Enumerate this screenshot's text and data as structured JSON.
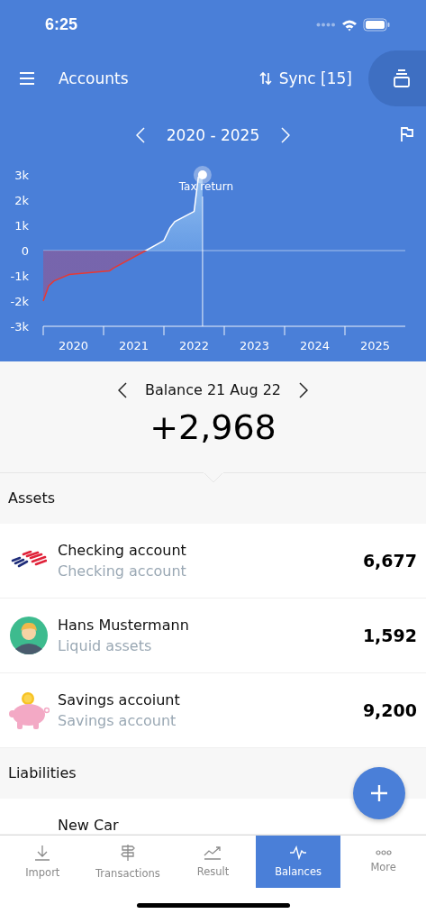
{
  "status_bar": {
    "time": "6:25"
  },
  "header": {
    "title": "Accounts",
    "sync": "Sync [15]"
  },
  "period": {
    "label": "2020 - 2025"
  },
  "chart": {
    "chart_data": {
      "type": "area",
      "x": [
        2020.0,
        2020.09,
        2020.18,
        2020.43,
        2021.1,
        2021.16,
        2021.7,
        2022.0,
        2022.1,
        2022.18,
        2022.5,
        2022.57,
        2022.64
      ],
      "series": [
        {
          "color": "#ffffff",
          "values": [
            -2000,
            -1400,
            -1200,
            -950,
            -800,
            -700,
            0,
            400,
            900,
            1150,
            1550,
            2900,
            3000
          ]
        }
      ],
      "ref_lines": [
        {
          "axis": "x",
          "value": 2022.64
        }
      ],
      "xlim": [
        2020,
        2026
      ],
      "ylim": [
        -3000,
        3000
      ],
      "xticks": [
        {
          "value": 2020.5,
          "label": "2020"
        },
        {
          "value": 2021.5,
          "label": "2021"
        },
        {
          "value": 2022.5,
          "label": "2022"
        },
        {
          "value": 2023.5,
          "label": "2023"
        },
        {
          "value": 2024.5,
          "label": "2024"
        },
        {
          "value": 2025.5,
          "label": "2025"
        }
      ],
      "yticks": [
        {
          "value": 3000,
          "label": "3k"
        },
        {
          "value": 2000,
          "label": "2k"
        },
        {
          "value": 1000,
          "label": "1k"
        },
        {
          "value": 0,
          "label": "0"
        },
        {
          "value": -1000,
          "label": "-1k"
        },
        {
          "value": -2000,
          "label": "-2k"
        },
        {
          "value": -3000,
          "label": "-3k"
        }
      ],
      "annotations": [
        {
          "x": 2022.64,
          "y": 3000,
          "text": "Tax return"
        }
      ]
    }
  },
  "balance": {
    "label": "Balance 21 Aug 22",
    "amount": "+2,968"
  },
  "sections": [
    {
      "title": "Assets",
      "accounts": [
        {
          "kind": "bank",
          "name": "Checking account",
          "subtitle": "Checking account",
          "amount": "6,677"
        },
        {
          "kind": "person",
          "name": "Hans Mustermann",
          "subtitle": "Liquid assets",
          "amount": "1,592"
        },
        {
          "kind": "piggy",
          "name": "Savings accoiunt",
          "subtitle": "Savings account",
          "amount": "9,200"
        }
      ]
    },
    {
      "title": "Liabilities",
      "accounts": [
        {
          "kind": "plain",
          "name": "New Car"
        }
      ]
    }
  ],
  "tabs": [
    {
      "kind": "import",
      "label": "Import",
      "selected": false
    },
    {
      "kind": "transactions",
      "label": "Transactions",
      "selected": false
    },
    {
      "kind": "result",
      "label": "Result",
      "selected": false
    },
    {
      "kind": "balances",
      "label": "Balances",
      "selected": true
    },
    {
      "kind": "more",
      "label": "More",
      "selected": false
    }
  ]
}
